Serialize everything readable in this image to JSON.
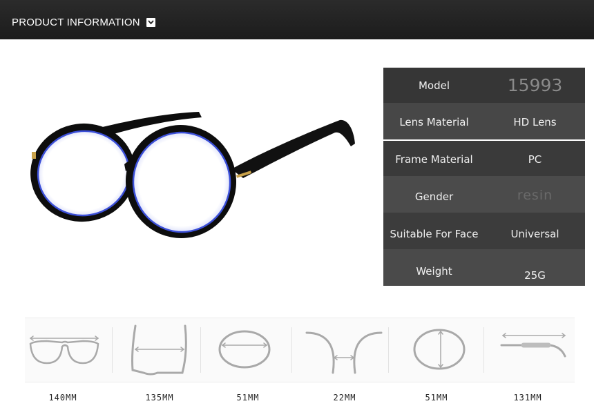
{
  "header": {
    "title": "PRODUCT INFORMATION",
    "icon": "chevron-down-icon"
  },
  "product": {
    "image": "round-glasses-photo"
  },
  "specs": [
    {
      "label": "Model",
      "value": "15993"
    },
    {
      "label": "Lens Material",
      "value": "HD Lens"
    },
    {
      "label": "Frame Material",
      "value": "PC"
    },
    {
      "label": "Gender",
      "value": "resin"
    },
    {
      "label": "Suitable For Face",
      "value": "Universal"
    },
    {
      "label": "Weight",
      "value": "25G"
    }
  ],
  "colors": {
    "header_bg": "#222222",
    "table_dark": "#3a3a3a",
    "table_mid": "#4a4a4a",
    "frame_black": "#0d0d0d",
    "lens_blue": "#3b4fd8",
    "gold_accent": "#c9a24a"
  },
  "measurements": [
    {
      "icon": "frame-width-icon",
      "value": "140MM"
    },
    {
      "icon": "temple-spread-icon",
      "value": "135MM"
    },
    {
      "icon": "lens-width-icon",
      "value": "51MM"
    },
    {
      "icon": "bridge-width-icon",
      "value": "22MM"
    },
    {
      "icon": "lens-height-icon",
      "value": "51MM"
    },
    {
      "icon": "temple-length-icon",
      "value": "131MM"
    }
  ]
}
